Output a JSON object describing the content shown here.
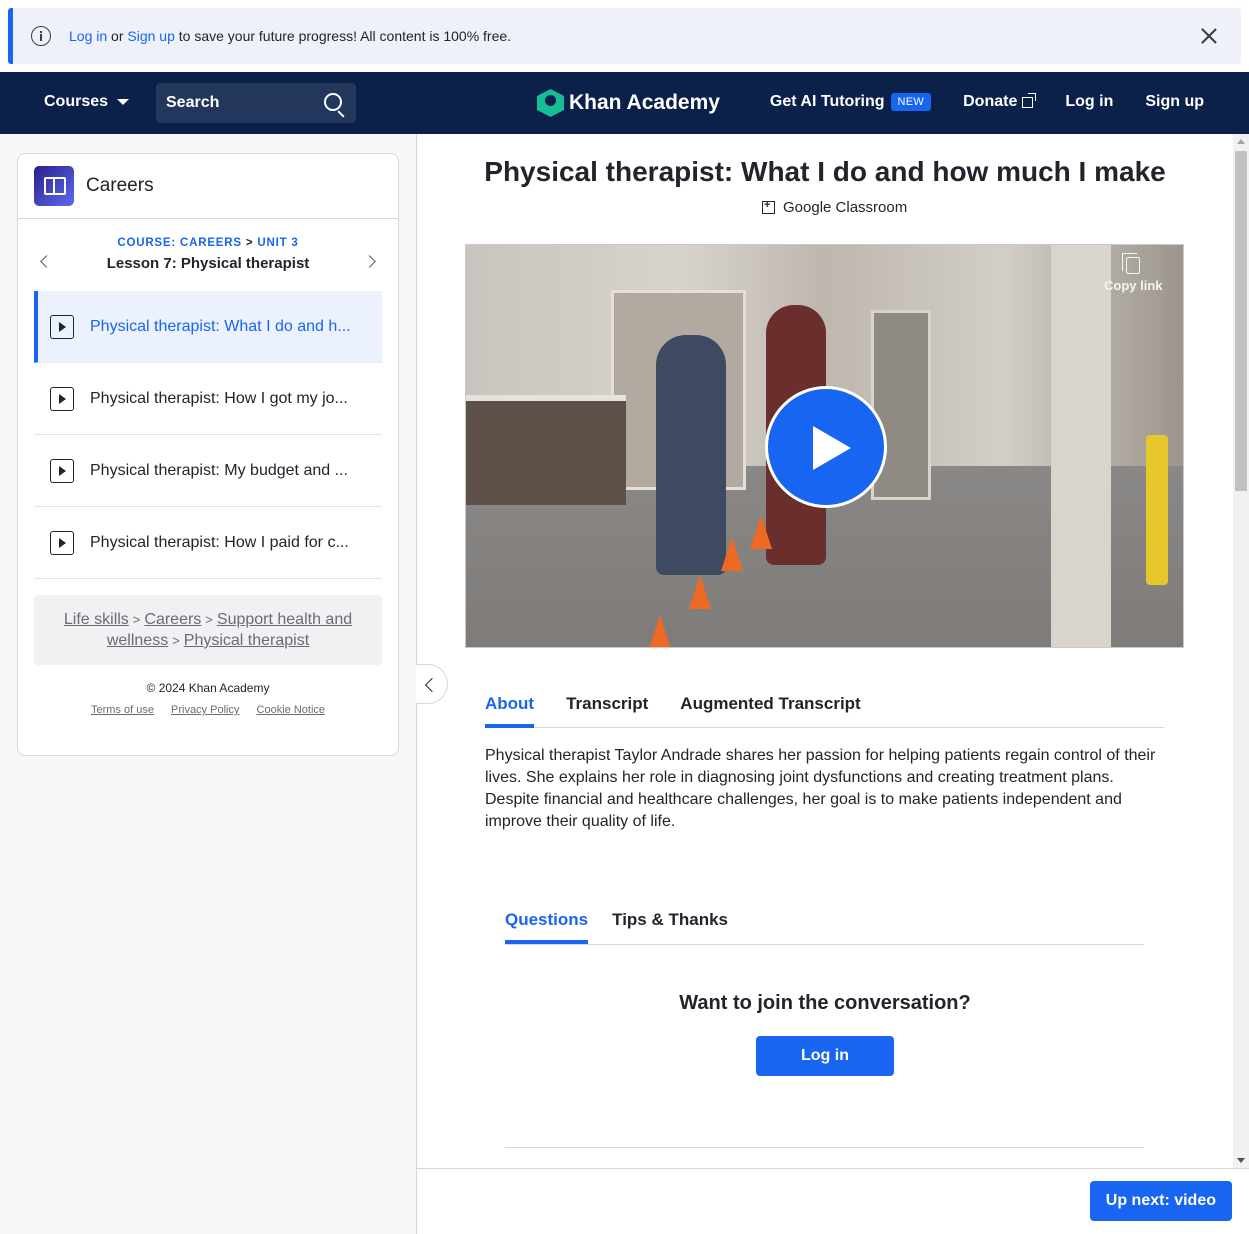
{
  "banner": {
    "login_link": "Log in",
    "or": "or",
    "signup_link": "Sign up",
    "message": "to save your future progress! All content is 100% free."
  },
  "nav": {
    "courses": "Courses",
    "search_placeholder": "Search",
    "logo": "Khan Academy",
    "ai_tutoring": "Get AI Tutoring",
    "new_badge": "NEW",
    "donate": "Donate",
    "login": "Log in",
    "signup": "Sign up"
  },
  "sidebar": {
    "course_title": "Careers",
    "crumb_course": "COURSE: CAREERS",
    "crumb_sep": ">",
    "crumb_unit": "UNIT 3",
    "lesson_title": "Lesson 7: Physical therapist",
    "items": [
      {
        "label": "Physical therapist: What I do and h...",
        "active": true
      },
      {
        "label": "Physical therapist: How I got my jo...",
        "active": false
      },
      {
        "label": "Physical therapist: My budget and ...",
        "active": false
      },
      {
        "label": "Physical therapist: How I paid for c...",
        "active": false
      }
    ],
    "breadcrumbs": [
      "Life skills",
      "Careers",
      "Support health and",
      "wellness",
      "Physical therapist"
    ],
    "copyright": "© 2024 Khan Academy",
    "footer_links": [
      "Terms of use",
      "Privacy Policy",
      "Cookie Notice"
    ]
  },
  "main": {
    "title": "Physical therapist: What I do and how much I make",
    "google_classroom": "Google Classroom",
    "copy_link": "Copy link",
    "tabs": [
      "About",
      "Transcript",
      "Augmented Transcript"
    ],
    "active_tab": "About",
    "description": "Physical therapist Taylor Andrade shares her passion for helping patients regain control of their lives. She explains her role in diagnosing joint dysfunctions and creating treatment plans. Despite financial and healthcare challenges, her goal is to make patients independent and improve their quality of life.",
    "discussion_tabs": [
      "Questions",
      "Tips & Thanks"
    ],
    "join_prompt": "Want to join the conversation?",
    "join_login": "Log in",
    "up_next": "Up next: video"
  },
  "colors": {
    "accent": "#1865f2",
    "nav_bg": "#0b2149",
    "logo_green": "#14bf96"
  }
}
